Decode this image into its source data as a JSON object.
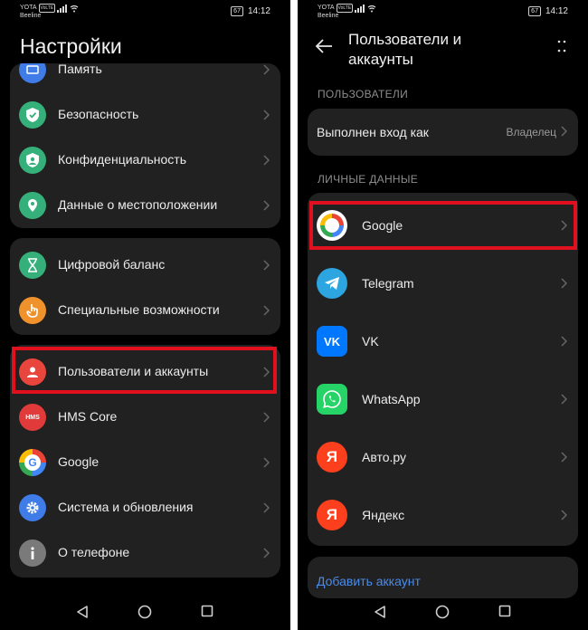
{
  "status": {
    "carrier_top": "YOTA",
    "volte": "VoLTE",
    "carrier_bottom": "Beeline",
    "battery": "67",
    "time": "14:12"
  },
  "left": {
    "title": "Настройки",
    "group1": [
      {
        "label": "Память",
        "icon": "storage-icon"
      },
      {
        "label": "Безопасность",
        "icon": "shield-icon"
      },
      {
        "label": "Конфиденциальность",
        "icon": "privacy-icon"
      },
      {
        "label": "Данные о местоположении",
        "icon": "location-icon"
      }
    ],
    "group2": [
      {
        "label": "Цифровой баланс",
        "icon": "hourglass-icon"
      },
      {
        "label": "Специальные возможности",
        "icon": "hand-icon"
      }
    ],
    "group3": [
      {
        "label": "Пользователи и аккаунты",
        "icon": "user-icon"
      },
      {
        "label": "HMS Core",
        "icon": "hms-icon",
        "badge": "HMS"
      },
      {
        "label": "Google",
        "icon": "google-icon"
      },
      {
        "label": "Система и обновления",
        "icon": "gear-icon"
      },
      {
        "label": "О телефоне",
        "icon": "info-icon"
      }
    ]
  },
  "right": {
    "title": "Пользователи и аккаунты",
    "section_users": "ПОЛЬЗОВАТЕЛИ",
    "signed_in_label": "Выполнен вход как",
    "signed_in_value": "Владелец",
    "section_personal": "ЛИЧНЫЕ ДАННЫЕ",
    "accounts": [
      {
        "label": "Google",
        "icon": "google-icon"
      },
      {
        "label": "Telegram",
        "icon": "telegram-icon"
      },
      {
        "label": "VK",
        "icon": "vk-icon",
        "badge": "VK"
      },
      {
        "label": "WhatsApp",
        "icon": "whatsapp-icon"
      },
      {
        "label": "Авто.ру",
        "icon": "yandex-auto-icon",
        "badge": "Я"
      },
      {
        "label": "Яндекс",
        "icon": "yandex-icon",
        "badge": "Я"
      }
    ],
    "add_account": "Добавить аккаунт"
  },
  "colors": {
    "highlight": "#e0101e",
    "accent_blue": "#4a8bea",
    "card": "#212121"
  }
}
